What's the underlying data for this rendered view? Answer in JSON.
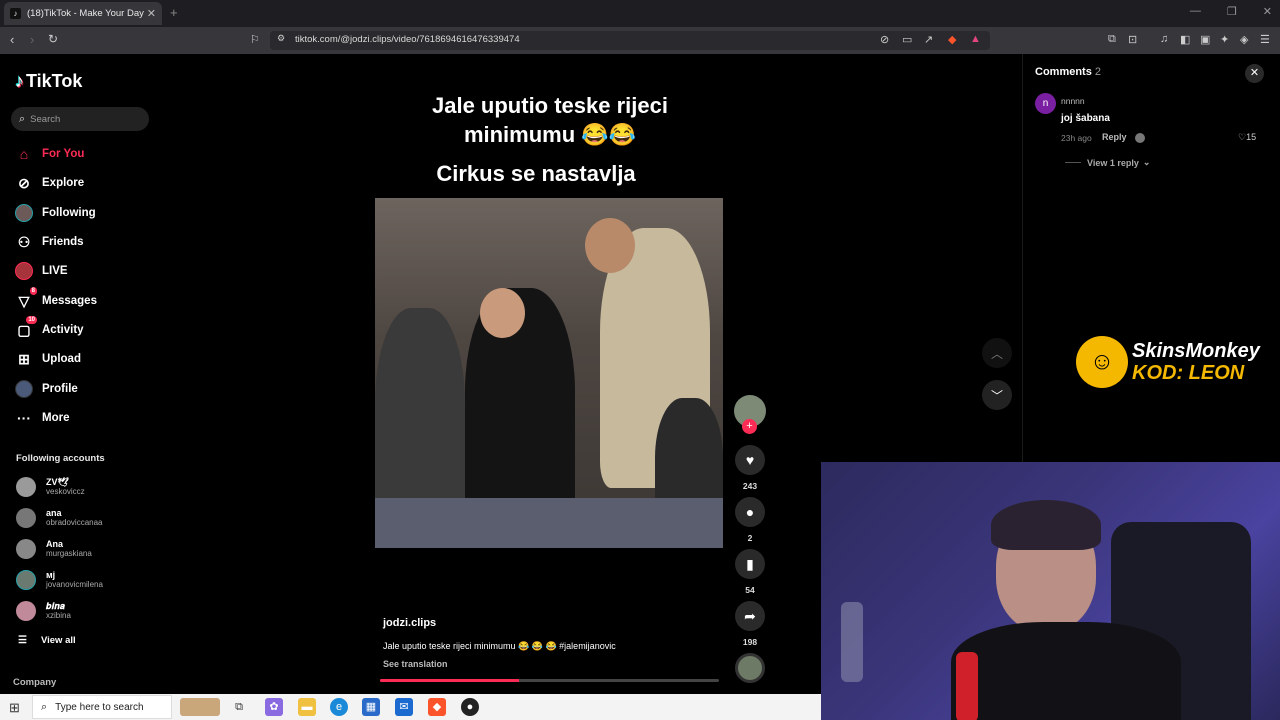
{
  "browser": {
    "tab_title": "(18)TikTok - Make Your Day",
    "new_tab": "+",
    "url": "tiktok.com/@jodzi.clips/video/7618694616476339474"
  },
  "sidebar": {
    "logo": "TikTok",
    "search_placeholder": "Search",
    "nav": [
      {
        "label": "For You",
        "icon": "home-icon"
      },
      {
        "label": "Explore",
        "icon": "compass-icon"
      },
      {
        "label": "Following",
        "icon": "avatar-icon"
      },
      {
        "label": "Friends",
        "icon": "friends-icon"
      },
      {
        "label": "LIVE",
        "icon": "live-icon"
      },
      {
        "label": "Messages",
        "icon": "send-icon",
        "badge": "8"
      },
      {
        "label": "Activity",
        "icon": "inbox-icon",
        "badge": "10"
      },
      {
        "label": "Upload",
        "icon": "plus-square-icon"
      },
      {
        "label": "Profile",
        "icon": "profile-icon"
      },
      {
        "label": "More",
        "icon": "dots-icon"
      }
    ],
    "following_title": "Following accounts",
    "accounts": [
      {
        "name": "ZV🕊",
        "user": "veskoviccz"
      },
      {
        "name": "ana",
        "user": "obradoviccanaa"
      },
      {
        "name": "Ana",
        "user": "murgaskiana"
      },
      {
        "name": "мј",
        "user": "jovanovicmilena"
      },
      {
        "name": "𝒃𝒊𝒏𝒂",
        "user": "xzibina"
      }
    ],
    "view_all": "View all",
    "company": "Company"
  },
  "video": {
    "caption_line1": "Jale uputio teske rijeci minimumu 😂😂",
    "caption_line2": "Cirkus se nastavlja",
    "author": "jodzi.clips",
    "description": "Jale uputio teske rijeci minimumu 😂 😂 😂 #jalemijanovic",
    "see_translation": "See translation",
    "progress": 0.41,
    "likes": "243",
    "comments": "2",
    "saves": "54",
    "shares": "198"
  },
  "comments": {
    "title": "Comments",
    "count": "2",
    "items": [
      {
        "avatar_letter": "n",
        "user": "nnnnn",
        "text": "joj šabana",
        "time": "23h ago",
        "reply": "Reply",
        "likes": "15",
        "view_replies": "View 1 reply"
      }
    ]
  },
  "sponsor": {
    "line1": "SkinsMonkey",
    "line2": "KOD: LEON"
  },
  "taskbar": {
    "search_placeholder": "Type here to search"
  },
  "colors": {
    "accent": "#fe2c55",
    "sponsor_yellow": "#f5b800"
  }
}
